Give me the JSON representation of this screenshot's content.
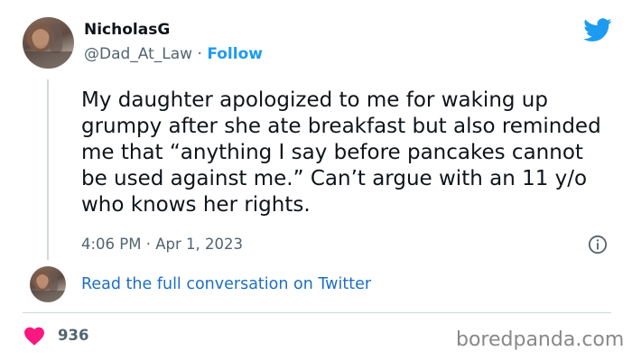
{
  "tweet": {
    "author_name": "NicholasG",
    "handle": "@Dad_At_Law",
    "separator": " · ",
    "follow_label": "Follow",
    "text": "My daughter apologized to me for waking up grumpy after she ate breakfast but also reminded me that “anything I say before pancakes cannot be used against me.” Can’t argue with an 11 y/o who knows her rights.",
    "timestamp": "4:06 PM · Apr 1, 2023",
    "read_more_label": "Read the full conversation on Twitter",
    "like_count": "936"
  },
  "icons": {
    "brand": "twitter-bird-icon",
    "info": "info-icon",
    "like": "heart-icon"
  },
  "colors": {
    "accent": "#1d9bf0",
    "like": "#f91880",
    "secondary_text": "#536471"
  },
  "watermark": "boredpanda.com"
}
